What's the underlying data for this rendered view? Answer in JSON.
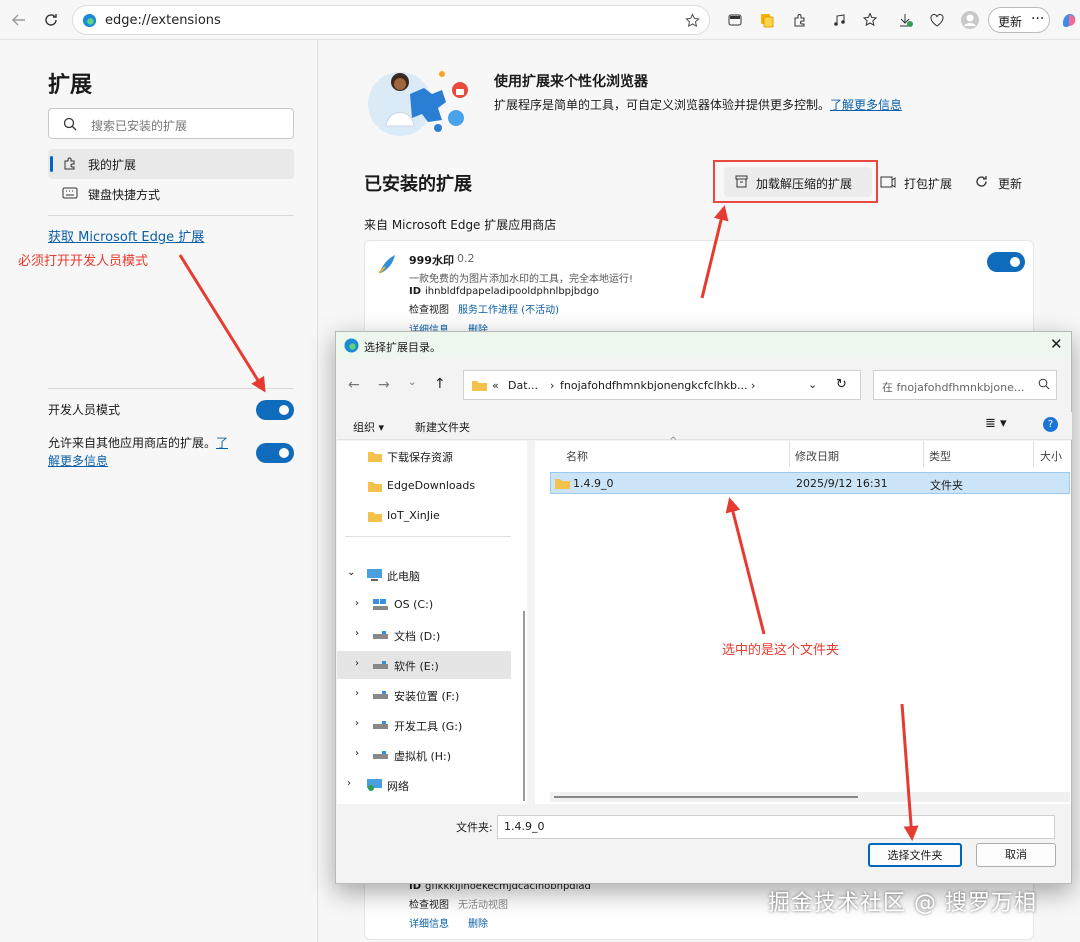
{
  "browser": {
    "url": "edge://extensions",
    "update_label": "更新"
  },
  "sidebar": {
    "title": "扩展",
    "search_placeholder": "搜索已安装的扩展",
    "items": [
      {
        "label": "我的扩展"
      },
      {
        "label": "键盘快捷方式"
      }
    ],
    "get_extensions_link": "获取 Microsoft Edge 扩展",
    "dev_mode_label": "开发人员模式",
    "dev_mode_on": true,
    "allow_other_stores_text": "允许来自其他应用商店的扩展。",
    "allow_other_stores_link_a": "了",
    "allow_other_stores_link_b": "解更多信息",
    "allow_other_stores_on": true
  },
  "annotations": {
    "dev_mode_note": "必须打开开发人员模式",
    "folder_note": "选中的是这个文件夹"
  },
  "main": {
    "promo_title": "使用扩展来个性化浏览器",
    "promo_desc": "扩展程序是简单的工具，可自定义浏览器体验并提供更多控制。",
    "promo_link": "了解更多信息",
    "installed_heading": "已安装的扩展",
    "load_unpacked": "加载解压缩的扩展",
    "pack_extension": "打包扩展",
    "update": "更新",
    "from_store": "来自 Microsoft Edge 扩展应用商店",
    "ext1": {
      "name": "999水印",
      "version": "0.2",
      "desc": "一款免费的为图片添加水印的工具，完全本地运行!",
      "id_label": "ID",
      "id": "ihnbldfdpapeladipooldphnlbpjbdgo",
      "inspect_label": "检查视图",
      "inspect_link": "服务工作进程 (不活动)",
      "details": "详细信息",
      "remove": "删除",
      "enabled": true
    },
    "ext2": {
      "id_label": "ID",
      "id": "gfikkkijlhoekecmjdcacinobhpdiad",
      "inspect_label": "检查视图",
      "inspect_value": "无活动视图",
      "details": "详细信息",
      "remove": "删除"
    }
  },
  "dialog": {
    "title": "选择扩展目录。",
    "breadcrumb_1": "Dat...",
    "breadcrumb_2": "fnojafohdfhmnkbjonengkcfclhkb...",
    "search_placeholder": "在 fnojafohdfhmnkbjone...",
    "organize": "组织 ▾",
    "new_folder": "新建文件夹",
    "quick_access": [
      {
        "label": "下载保存资源"
      },
      {
        "label": "EdgeDownloads"
      },
      {
        "label": "IoT_XinJie"
      }
    ],
    "this_pc": "此电脑",
    "drives": [
      {
        "label": "OS (C:)"
      },
      {
        "label": "文档 (D:)"
      },
      {
        "label": "软件 (E:)"
      },
      {
        "label": "安装位置 (F:)"
      },
      {
        "label": "开发工具 (G:)"
      },
      {
        "label": "虚拟机 (H:)"
      }
    ],
    "network": "网络",
    "columns": {
      "name": "名称",
      "modified": "修改日期",
      "type": "类型",
      "size": "大小"
    },
    "files": [
      {
        "name": "1.4.9_0",
        "modified": "2025/9/12 16:31",
        "type": "文件夹"
      }
    ],
    "folder_label": "文件夹:",
    "folder_value": "1.4.9_0",
    "select_button": "选择文件夹",
    "cancel_button": "取消"
  },
  "watermark": "掘金技术社区 @ 搜罗万相",
  "colors": {
    "accent": "#0f6cbd",
    "annotation": "#e63b30"
  }
}
